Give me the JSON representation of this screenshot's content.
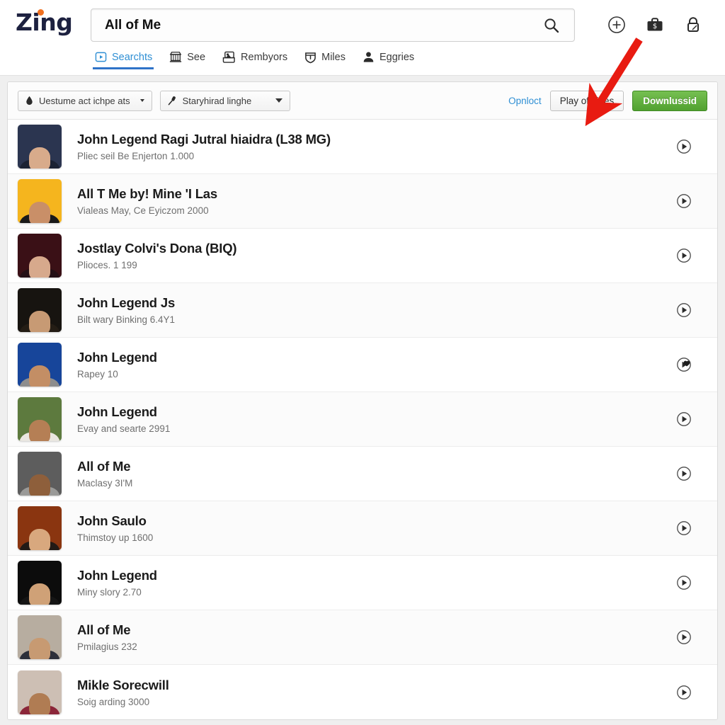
{
  "brand": {
    "name": "Zing"
  },
  "search": {
    "value": "All of Me",
    "placeholder": "All of Me",
    "icon": "search-icon"
  },
  "header_icons": [
    {
      "name": "plus-circle-icon",
      "label": "Add"
    },
    {
      "name": "briefcase-icon",
      "label": "Briefcase"
    },
    {
      "name": "lock-icon",
      "label": "Lock"
    }
  ],
  "tabs": [
    {
      "label": "Searchts",
      "icon": "video-box-icon",
      "active": true
    },
    {
      "label": "See",
      "icon": "store-icon",
      "active": false
    },
    {
      "label": "Rembyors",
      "icon": "photo-box-icon",
      "active": false
    },
    {
      "label": "Miles",
      "icon": "shield-icon",
      "active": false
    },
    {
      "label": "Eggries",
      "icon": "person-icon",
      "active": false
    }
  ],
  "toolbar": {
    "filter_one": {
      "label": "Uestume act ichpe ats",
      "icon": "droplet-icon"
    },
    "filter_two": {
      "label": "Staryhirad linghe",
      "icon": "mic-icon"
    },
    "option_link": "Opnloct",
    "play_button": "Play of Ilines",
    "download_button": "Downlussid",
    "accent_green": "#5fae3a",
    "accent_blue": "#2f8fd4"
  },
  "results": [
    {
      "title": "John Legend Ragi Jutral hiaidra (L38 MG)",
      "sub": "Pliec seil Be Enjerton 1.000",
      "thumb_bg": "#2b3550",
      "torso": "#1b2233",
      "skin": "#d8ab8b",
      "play": "play-circle-icon"
    },
    {
      "title": "All T Me by! Mine 'I Las",
      "sub": "Vialeas May, Ce Eyiczom 2000",
      "thumb_bg": "#f5b51e",
      "torso": "#1a1a1a",
      "skin": "#c98f68",
      "play": "play-circle-icon"
    },
    {
      "title": "Jostlay Colvi's Dona (BIQ)",
      "sub": "Plioces. 1 199",
      "thumb_bg": "#3a1016",
      "torso": "#241016",
      "skin": "#d7a98c",
      "play": "play-circle-icon"
    },
    {
      "title": "John Legend Js",
      "sub": "Bilt wary Binking 6.4Y1",
      "thumb_bg": "#171410",
      "torso": "#241d15",
      "skin": "#c79a74",
      "play": "play-circle-icon"
    },
    {
      "title": "John Legend",
      "sub": "Rapey 10",
      "thumb_bg": "#17459a",
      "torso": "#8d8d8d",
      "skin": "#c38e65",
      "play": "play-heart-icon"
    },
    {
      "title": "John Legend",
      "sub": "Evay and searte 2991",
      "thumb_bg": "#5d7a3e",
      "torso": "#e9e6e0",
      "skin": "#b57f55",
      "play": "play-circle-icon"
    },
    {
      "title": "All of Me",
      "sub": "Maclasy 3I'M",
      "thumb_bg": "#5d5d5d",
      "torso": "#9a9a98",
      "skin": "#8e5f3b",
      "play": "play-circle-icon"
    },
    {
      "title": "John Saulo",
      "sub": "Thimstoy up 1600",
      "thumb_bg": "#8a3510",
      "torso": "#221a16",
      "skin": "#d8a87e",
      "play": "play-circle-icon"
    },
    {
      "title": "John Legend",
      "sub": "Miny slory 2.70",
      "thumb_bg": "#0c0c0c",
      "torso": "#151515",
      "skin": "#cfa177",
      "play": "play-circle-icon"
    },
    {
      "title": "All of Me",
      "sub": "Pmilagius 232",
      "thumb_bg": "#b7ada0",
      "torso": "#2c2f3a",
      "skin": "#c79a72",
      "play": "play-circle-icon"
    },
    {
      "title": "Mikle Sorecwill",
      "sub": "Soig arding 3000",
      "thumb_bg": "#cdbfb4",
      "torso": "#8b2639",
      "skin": "#b07c53",
      "play": "play-circle-icon"
    }
  ],
  "annotation": {
    "arrow_color": "#e81b11",
    "points_to": "play-of-ilines-button"
  }
}
